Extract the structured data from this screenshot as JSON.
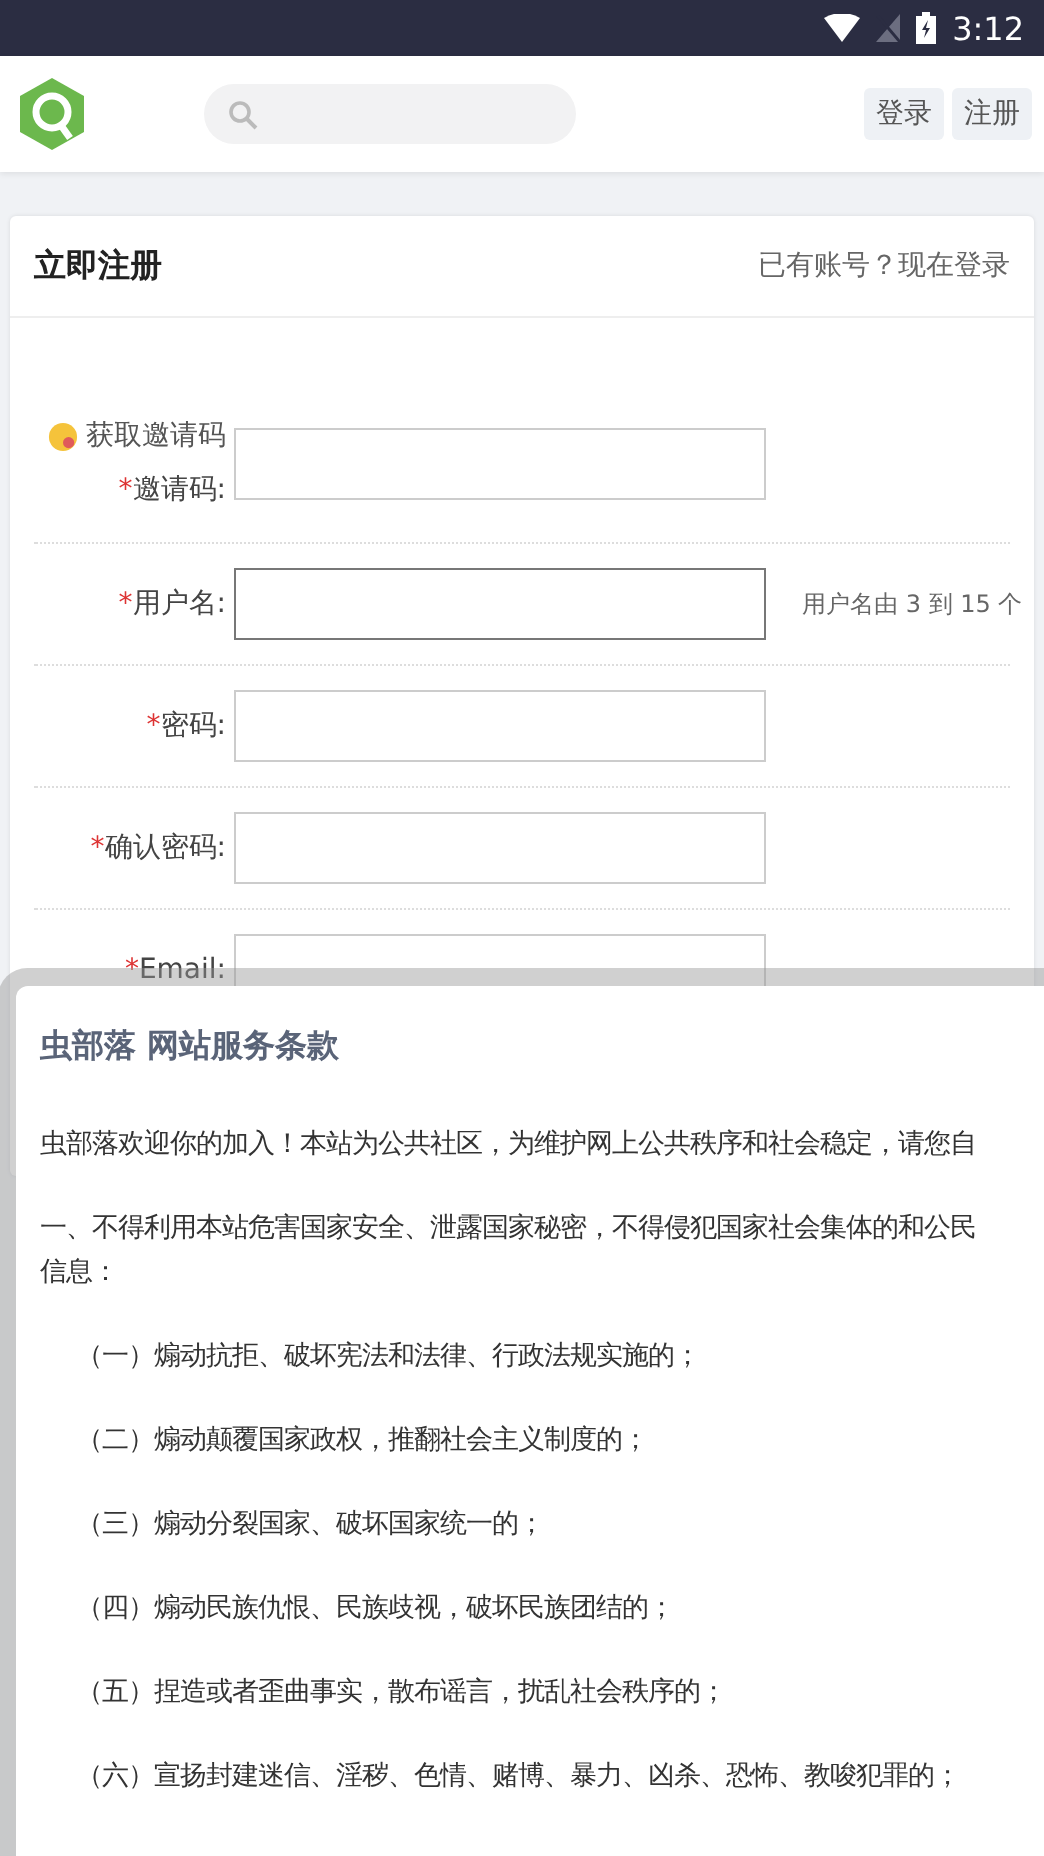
{
  "status_bar": {
    "time": "3:12"
  },
  "header": {
    "buttons": [
      "登录",
      "注册"
    ]
  },
  "card": {
    "title": "立即注册",
    "login_link": "已有账号？现在登录"
  },
  "form": {
    "required_mark": "*",
    "fields": [
      {
        "link": "获取邀请码",
        "label": "邀请码:",
        "required": true,
        "focused": false
      },
      {
        "label": "用户名:",
        "required": true,
        "focused": true,
        "hint": "用户名由 3 到 15 个"
      },
      {
        "label": "密码:",
        "required": true,
        "focused": false
      },
      {
        "label": "确认密码:",
        "required": true,
        "focused": false
      },
      {
        "label": "Email:",
        "required": true,
        "focused": false
      }
    ]
  },
  "dialog": {
    "title": "虫部落 网站服务条款",
    "paragraphs": [
      {
        "kind": "text",
        "lines": [
          "虫部落欢迎你的加入！本站为公共社区，为维护网上公共秩序和社会稳定，请您自"
        ]
      },
      {
        "kind": "text",
        "lines": [
          "一、不得利用本站危害国家安全、泄露国家秘密，不得侵犯国家社会集体的和公民",
          "信息："
        ]
      },
      {
        "kind": "item",
        "lines": [
          "（一）煽动抗拒、破坏宪法和法律、行政法规实施的；"
        ]
      },
      {
        "kind": "item",
        "lines": [
          "（二）煽动颠覆国家政权，推翻社会主义制度的；"
        ]
      },
      {
        "kind": "item",
        "lines": [
          "（三）煽动分裂国家、破坏国家统一的；"
        ]
      },
      {
        "kind": "item",
        "lines": [
          "（四）煽动民族仇恨、民族歧视，破坏民族团结的；"
        ]
      },
      {
        "kind": "item",
        "lines": [
          "（五）捏造或者歪曲事实，散布谣言，扰乱社会秩序的；"
        ]
      },
      {
        "kind": "item",
        "lines": [
          "（六）宣扬封建迷信、淫秽、色情、赌博、暴力、凶杀、恐怖、教唆犯罪的；"
        ]
      }
    ]
  }
}
